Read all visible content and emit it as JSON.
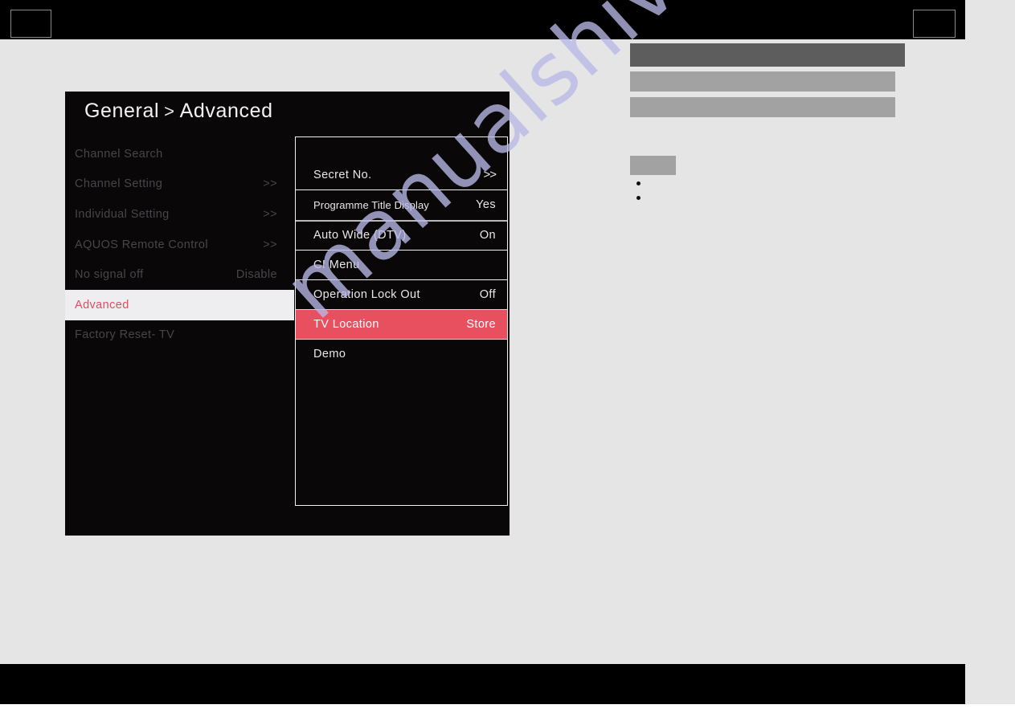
{
  "page": {
    "background_color": "#e5e5e5",
    "watermark": "manualshive.com",
    "watermark_color": "#b9b9e8"
  },
  "header": {
    "band_color": "#000000",
    "boxes": [
      {
        "name": "top-left-placeholder"
      },
      {
        "name": "top-right-placeholder"
      }
    ]
  },
  "footer": {
    "band_color": "#000000"
  },
  "osd": {
    "accent_color": "#e9505f",
    "selected_text_color": "#d94f63",
    "title": {
      "section": "General",
      "separator": ">",
      "page": "Advanced"
    },
    "left_menu": [
      {
        "label": "Channel Search",
        "value": "",
        "selected": false
      },
      {
        "label": "Channel Setting",
        "value": ">>",
        "selected": false
      },
      {
        "label": "Individual Setting",
        "value": ">>",
        "selected": false
      },
      {
        "label": "AQUOS Remote Control",
        "value": ">>",
        "selected": false
      },
      {
        "label": "No signal off",
        "value": "Disable",
        "selected": false
      },
      {
        "label": "Advanced",
        "value": "",
        "selected": true
      },
      {
        "label": "Factory Reset- TV",
        "value": "",
        "selected": false
      }
    ],
    "sub_menu": [
      {
        "label": "Secret No.",
        "value": ">>",
        "highlighted": false
      },
      {
        "label": "Programme Title Display",
        "value": "Yes",
        "highlighted": false
      },
      {
        "label": "Auto Wide (DTV)",
        "value": "On",
        "highlighted": false
      },
      {
        "label": "CI Menu",
        "value": "",
        "highlighted": false
      },
      {
        "label": "Operation Lock Out",
        "value": "Off",
        "highlighted": false
      },
      {
        "label": "TV Location",
        "value": "Store",
        "highlighted": true
      },
      {
        "label": "Demo",
        "value": "",
        "highlighted": false
      }
    ]
  },
  "redacted": {
    "blocks": [
      {
        "name": "heading-block",
        "color": "#5d5d5d"
      },
      {
        "name": "text-block-1",
        "color": "#a2a2a2"
      },
      {
        "name": "text-block-2",
        "color": "#a2a2a2"
      },
      {
        "name": "subheading-block",
        "color": "#a2a2a2"
      }
    ],
    "bullets": 2
  }
}
